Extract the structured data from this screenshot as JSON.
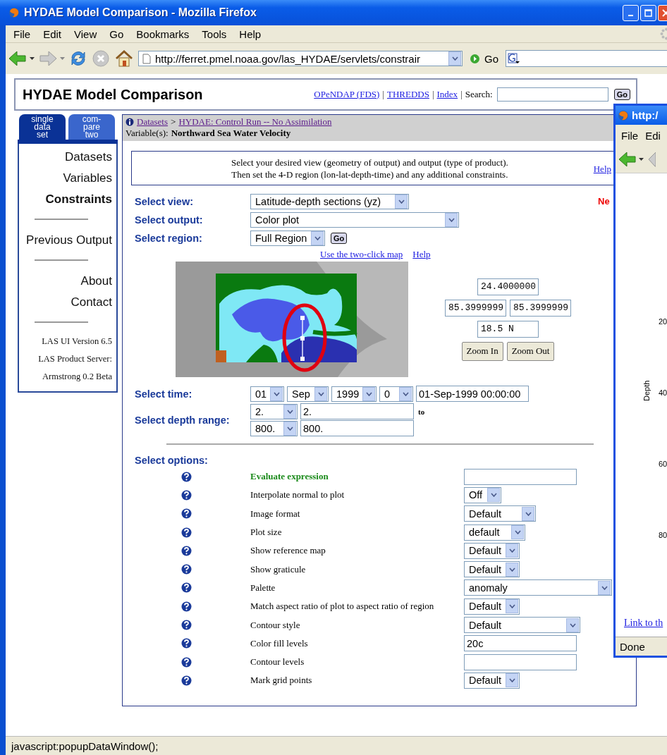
{
  "window": {
    "title": "HYDAE Model Comparison - Mozilla Firefox"
  },
  "menu": [
    "File",
    "Edit",
    "View",
    "Go",
    "Bookmarks",
    "Tools",
    "Help"
  ],
  "toolbar": {
    "url": "http://ferret.pmel.noaa.gov/las_HYDAE/servlets/constrair",
    "go": "Go"
  },
  "header": {
    "title": "HYDAE Model Comparison",
    "links": [
      "OPeNDAP (FDS)",
      "THREDDS",
      "Index"
    ],
    "separator": "|",
    "search_label": "Search:",
    "search_button": "Go"
  },
  "side_tabs": [
    {
      "lines": [
        "single",
        "data",
        "set"
      ],
      "selected": true
    },
    {
      "lines": [
        "com-",
        "pare",
        "two"
      ],
      "selected": false
    }
  ],
  "sidebar": {
    "groups": [
      [
        {
          "label": "Datasets",
          "selected": false
        },
        {
          "label": "Variables",
          "selected": false
        },
        {
          "label": "Constraints",
          "selected": true
        }
      ],
      [
        {
          "label": "Previous Output",
          "selected": false
        }
      ],
      [
        {
          "label": "About",
          "selected": false
        },
        {
          "label": "Contact",
          "selected": false
        }
      ]
    ],
    "info": [
      "LAS UI Version 6.5",
      "LAS Product Server:",
      "Armstrong 0.2 Beta"
    ]
  },
  "breadcrumb": {
    "links": [
      "Datasets",
      "HYDAE: Control Run -- No Assimilation"
    ],
    "separator": ">",
    "variable_label": "Variable(s):",
    "variable": "Northward Sea Water Velocity"
  },
  "instructions": {
    "lines": [
      "Select your desired view (geometry of output) and output (type of product).",
      "Then set the 4-D region (lon-lat-depth-time) and any additional constraints."
    ],
    "help": "Help"
  },
  "notice": "Ne",
  "view": {
    "label": "Select view:",
    "value": "Latitude-depth sections (yz)"
  },
  "output": {
    "label": "Select output:",
    "value": "Color plot"
  },
  "region": {
    "label": "Select region:",
    "value": "Full Region",
    "button": "Go"
  },
  "map_links": [
    "Use the two-click map",
    "Help"
  ],
  "coordinates": {
    "north": "24.4000000",
    "west": "85.3999999",
    "east": "85.3999999",
    "south": "18.5 N",
    "buttons": [
      "Zoom In",
      "Zoom Out"
    ]
  },
  "time": {
    "label": "Select time:",
    "selects": [
      "01",
      "Sep",
      "1999",
      "0"
    ],
    "value": "01-Sep-1999 00:00:00"
  },
  "depth": {
    "label": "Select depth range:",
    "rows": [
      {
        "select": "2.",
        "value": "2."
      },
      {
        "select": "800.",
        "value": "800."
      }
    ],
    "to": "to"
  },
  "options": {
    "label": "Select options:",
    "rows": [
      {
        "label": "Evaluate expression",
        "emphasis": true,
        "kind": "text",
        "value": ""
      },
      {
        "label": "Interpolate normal to plot",
        "emphasis": false,
        "kind": "select",
        "value": "Off"
      },
      {
        "label": "Image format",
        "emphasis": false,
        "kind": "select",
        "value": "Default"
      },
      {
        "label": "Plot size",
        "emphasis": false,
        "kind": "select",
        "value": "default"
      },
      {
        "label": "Show reference map",
        "emphasis": false,
        "kind": "select",
        "value": "Default"
      },
      {
        "label": "Show graticule",
        "emphasis": false,
        "kind": "select",
        "value": "Default"
      },
      {
        "label": "Palette",
        "emphasis": false,
        "kind": "select",
        "value": "anomaly"
      },
      {
        "label": "Match aspect ratio of plot to aspect ratio of region",
        "emphasis": false,
        "kind": "select",
        "value": "Default"
      },
      {
        "label": "Contour style",
        "emphasis": false,
        "kind": "select",
        "value": "Default"
      },
      {
        "label": "Color fill levels",
        "emphasis": false,
        "kind": "text",
        "value": "20c"
      },
      {
        "label": "Contour levels",
        "emphasis": false,
        "kind": "text",
        "value": ""
      },
      {
        "label": "Mark grid points",
        "emphasis": false,
        "kind": "select",
        "value": "Default"
      }
    ]
  },
  "status_bar": "javascript:popupDataWindow();",
  "popup": {
    "title": "http:/",
    "menu": [
      "File",
      "Edi"
    ],
    "axis_labels": [
      "20",
      "40",
      "60",
      "80"
    ],
    "axis_title": "Depth",
    "link": "Link to th",
    "status": "Done"
  }
}
